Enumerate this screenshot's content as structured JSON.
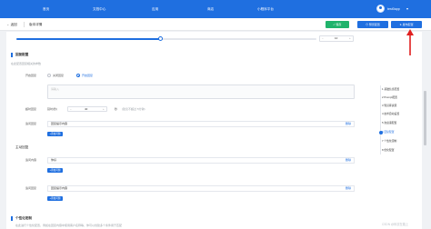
{
  "topnav": {
    "items": [
      "首页",
      "文档中心",
      "应用",
      "商店",
      "小程序平台"
    ],
    "username": "test0app",
    "caret": "▾"
  },
  "subheader": {
    "back_label": "← 返回",
    "title": "版本详情",
    "save_label": "✓ 保存",
    "preview_label": "⊙ 预览配置",
    "publish_label": "➤ 发布配置"
  },
  "slider": {
    "value": 10,
    "max": 10,
    "fill_fraction": 0.48,
    "minus": "−",
    "plus": "+"
  },
  "section_reply": {
    "title": "回复配置",
    "desc": "在此配置回复相关的参数",
    "row1_label": "开启回复",
    "radio1": "关闭回复",
    "radio2": "开启回复",
    "textarea_placeholder": "请输入",
    "row2_label": "超时回复",
    "delay_label": "延时(秒)",
    "delay_value": "40",
    "delay_unit": "秒",
    "delay_hint": "(建议不超过 5分钟)",
    "row3_label": "追问回复",
    "row3_value": "回复提示内容",
    "row3_link": "删除",
    "add_btn": "+添加问题"
  },
  "section_main": {
    "title": "主动回复",
    "row1_label": "追问内容",
    "row1_value": "你好",
    "row1_link": "删除",
    "add_btn1": "+添加问题",
    "row2_label": "追问回复",
    "row2_value": "回复提示内容",
    "row2_link": "删除",
    "add_btn2": "+添加问题"
  },
  "section_personal": {
    "title": "个性化定制",
    "desc": "在此进行个性化配置，例如在回复内容中使用客户名称等，你可以创建多个条件用于匹配"
  },
  "anchor_nav": {
    "items": [
      "1 基础信息配置",
      "2 Prompt配置",
      "3 知识库资源",
      "4 技术自动设置",
      "5 欢迎语配置",
      "6 回复配置",
      "7 个性化定制",
      "8 优化配置"
    ],
    "active_index": 5
  },
  "watermark": "CSDN @码农在路上",
  "colors": {
    "primary": "#1f6fe0",
    "success": "#20b36b",
    "arrow": "#e02020"
  }
}
